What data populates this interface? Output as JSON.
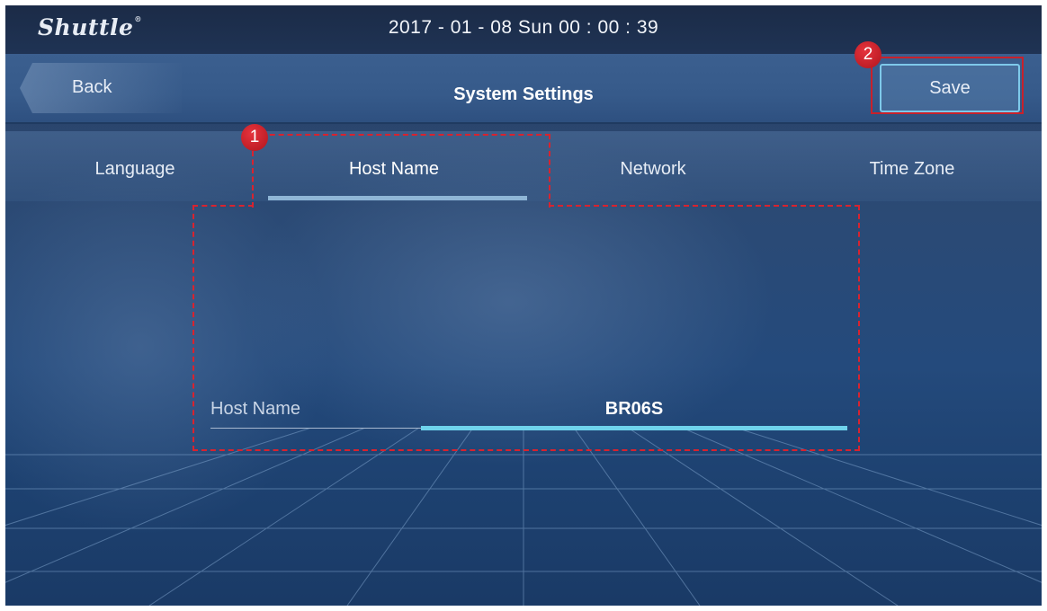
{
  "status_bar": {
    "logo": "Shuttle",
    "datetime": "2017 - 01 - 08  Sun  00 : 00 : 39"
  },
  "header": {
    "back_label": "Back",
    "title": "System Settings",
    "save_label": "Save"
  },
  "tabs": [
    {
      "label": "Language",
      "active": false
    },
    {
      "label": "Host Name",
      "active": true
    },
    {
      "label": "Network",
      "active": false
    },
    {
      "label": "Time Zone",
      "active": false
    }
  ],
  "host_name_field": {
    "label": "Host Name",
    "value": "BR06S"
  },
  "annotations": {
    "badge_1": "1",
    "badge_2": "2"
  },
  "colors": {
    "accent": "#6fd3ec",
    "annotation": "#d8232f"
  }
}
